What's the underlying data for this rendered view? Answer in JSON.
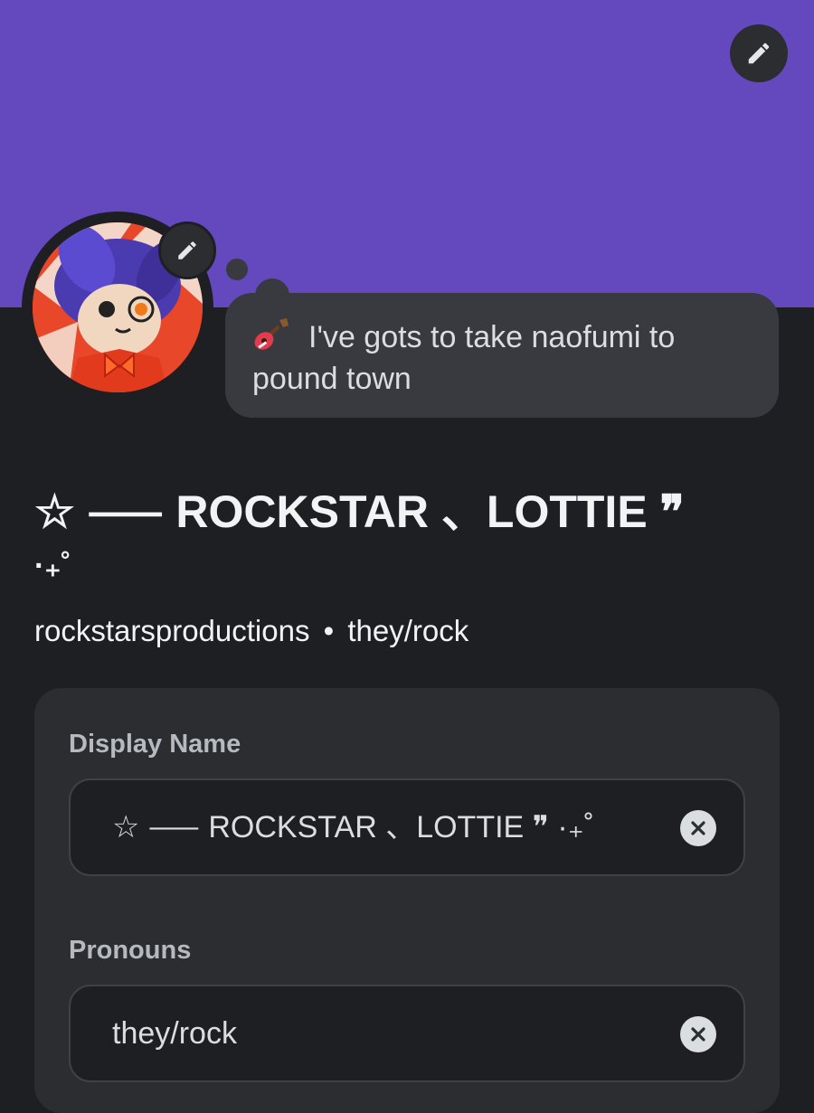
{
  "colors": {
    "banner": "#6349bd",
    "page_bg": "#1e1f22",
    "card_bg": "#2b2d31",
    "bubble_bg": "#383a40"
  },
  "banner": {
    "edit_icon": "pencil-icon"
  },
  "avatar": {
    "edit_icon": "pencil-icon"
  },
  "status": {
    "emoji": "guitar-icon",
    "text": "I've gots to take naofumi to pound town"
  },
  "profile": {
    "display_name": "☆ ⸺  ROCKSTAR  、LOTTIE ❞",
    "display_name_tail": "·₊˚",
    "username": "rockstarsproductions",
    "separator": "•",
    "pronouns": "they/rock"
  },
  "form": {
    "display_name_label": "Display Name",
    "display_name_value": "☆ ⸺  ROCKSTAR  、LOTTIE ❞  ·₊˚",
    "pronouns_label": "Pronouns",
    "pronouns_value": "they/rock",
    "clear_icon": "close-icon"
  }
}
